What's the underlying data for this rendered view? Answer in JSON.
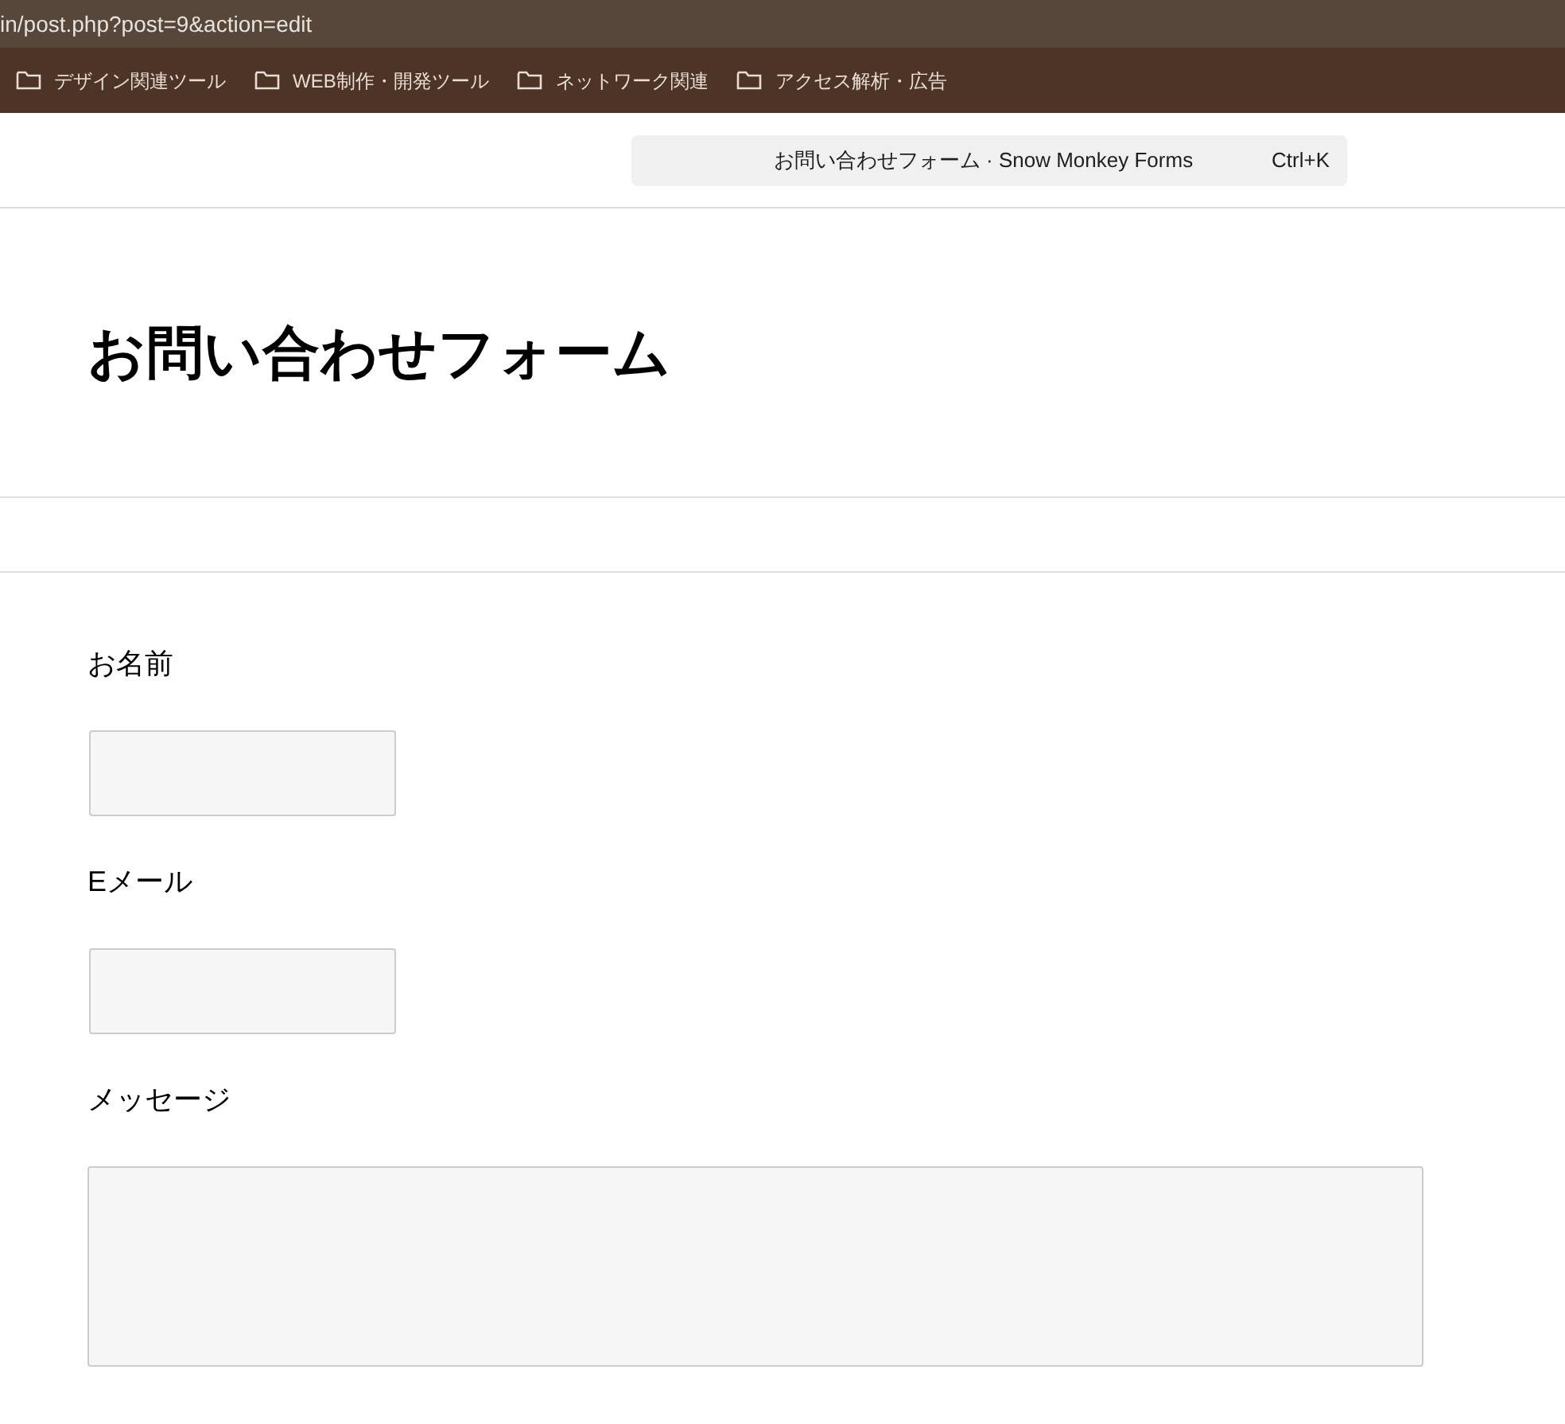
{
  "address_bar": {
    "url": "in/post.php?post=9&action=edit"
  },
  "bookmarks": [
    {
      "label": "デザイン関連ツール"
    },
    {
      "label": "WEB制作・開発ツール"
    },
    {
      "label": "ネットワーク関連"
    },
    {
      "label": "アクセス解析・広告"
    }
  ],
  "command_bar": {
    "title": "お問い合わせフォーム · Snow Monkey Forms",
    "shortcut": "Ctrl+K"
  },
  "post_title": "お問い合わせフォーム",
  "fields": [
    {
      "label": "お名前",
      "kind": "text"
    },
    {
      "label": "Eメール",
      "kind": "text"
    },
    {
      "label": "メッセージ",
      "kind": "textarea"
    }
  ]
}
